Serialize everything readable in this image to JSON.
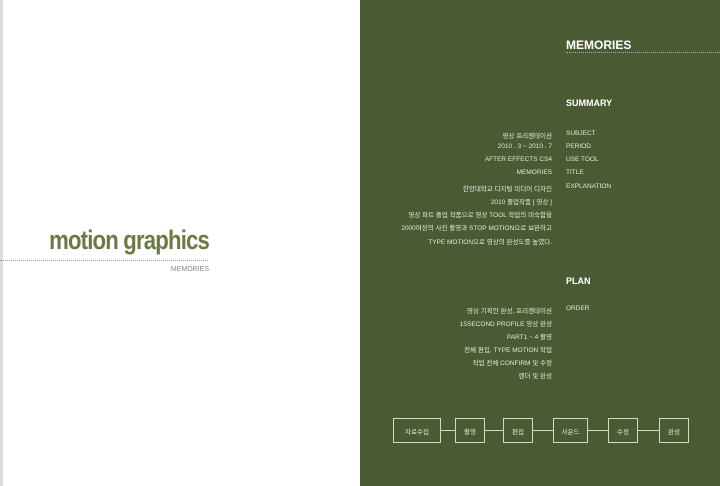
{
  "cover": {
    "title": "motion graphics",
    "subtitle": "MEMORIES"
  },
  "header": {
    "title": "MEMORIES"
  },
  "summary": {
    "heading": "SUMMARY",
    "rows": [
      {
        "label": "SUBJECT",
        "value": "영상 프리젠테이션"
      },
      {
        "label": "PERIOD",
        "value": "2010 . 3 ~ 2010 . 7"
      },
      {
        "label": "USE TOOL",
        "value": "AFTER EFFECTS CS4"
      },
      {
        "label": "TITLE",
        "value": "MEMORIES"
      },
      {
        "label": "EXPLANATION",
        "value": "한양대학교 디지털 미디어 디자인"
      }
    ],
    "explanation_more": [
      "2010 졸업작품 [ 영상 ]",
      "영상 파트 졸업 작품으로 영상 TOOL 작업의 미숙함을",
      "2000여장의 사진 촬영과 STOP MOTION으로 보완하고",
      "TYPE MOTION으로 영상의 완성도를 높였다."
    ]
  },
  "plan": {
    "heading": "PLAN",
    "label": "ORDER",
    "steps": [
      "영상 기획안 완성, 프리젠테이션",
      "15SECOND PROFILE 영상 완성",
      "PART1 ~ 4 촬영",
      "전체 편집, TYPE MOTION 작업",
      "작업 전체 CONFIRM 및 수정",
      "렌더 및 완성"
    ]
  },
  "process": [
    "자료수집",
    "촬영",
    "편집",
    "사운드",
    "수정",
    "완성"
  ]
}
